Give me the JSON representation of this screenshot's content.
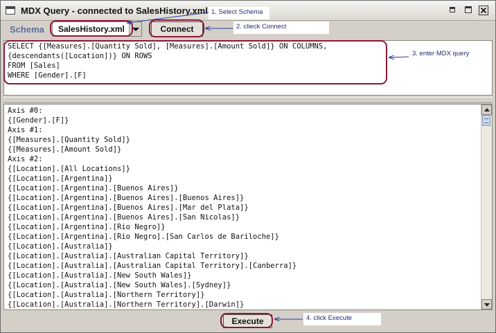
{
  "window": {
    "title": "MDX Query - connected to SalesHistory.xml"
  },
  "toolbar": {
    "schema_label": "Schema",
    "schema_value": "SalesHistory.xml",
    "connect_label": "Connect"
  },
  "query": {
    "lines": [
      "SELECT {[Measures].[Quantity Sold], [Measures].[Amount Sold]} ON COLUMNS,",
      "{descendants([Location])} ON ROWS",
      "FROM [Sales]",
      "WHERE [Gender].[F]"
    ]
  },
  "results": {
    "lines": [
      "Axis #0:",
      "{[Gender].[F]}",
      "Axis #1:",
      "{[Measures].[Quantity Sold]}",
      "{[Measures].[Amount Sold]}",
      "Axis #2:",
      "{[Location].[All Locations]}",
      "{[Location].[Argentina]}",
      "{[Location].[Argentina].[Buenos Aires]}",
      "{[Location].[Argentina].[Buenos Aires].[Buenos Aires]}",
      "{[Location].[Argentina].[Buenos Aires].[Mar del Plata]}",
      "{[Location].[Argentina].[Buenos Aires].[San Nicolas]}",
      "{[Location].[Argentina].[Rio Negro]}",
      "{[Location].[Argentina].[Rio Negro].[San Carlos de Bariloche]}",
      "{[Location].[Australia]}",
      "{[Location].[Australia].[Australian Capital Territory]}",
      "{[Location].[Australia].[Australian Capital Territory].[Canberra]}",
      "{[Location].[Australia].[New South Wales]}",
      "{[Location].[Australia].[New South Wales].[Sydney]}",
      "{[Location].[Australia].[Northern Territory]}",
      "{[Location].[Australia].[Northern Territory].[Darwin]}"
    ]
  },
  "actions": {
    "execute_label": "Execute"
  },
  "annotations": {
    "step1": "1. Select Schema",
    "step2": "2. clieck Connect",
    "step3": "3. enter MDX query",
    "step4": "4. click Execute"
  },
  "colors": {
    "highlight_ring": "#8b1838",
    "annotation_arrow": "#2b3a9a",
    "schema_label": "#5a6e9a"
  },
  "icons": {
    "app": "window-icon",
    "minimize": "minimize-icon",
    "maximize": "maximize-icon",
    "close": "close-icon"
  }
}
